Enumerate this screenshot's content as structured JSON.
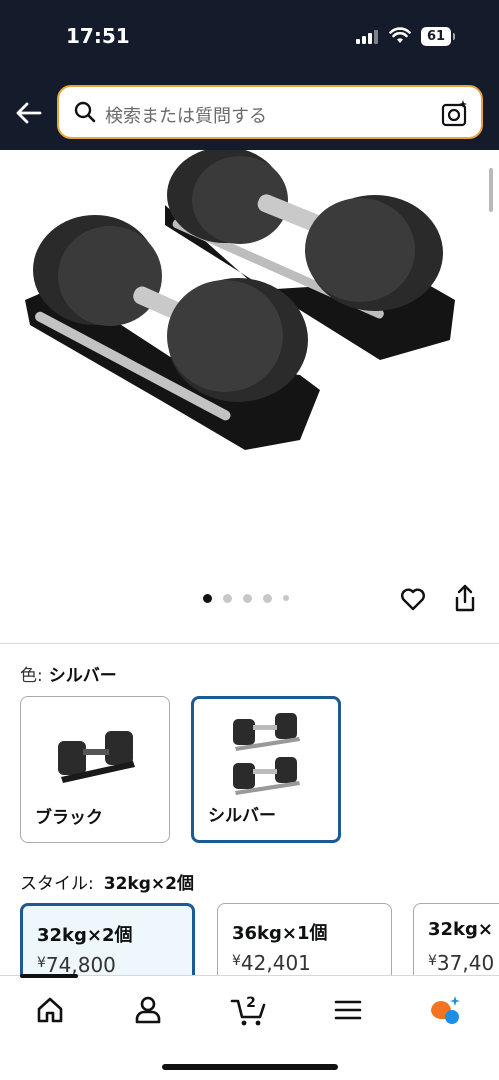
{
  "status_bar": {
    "time": "17:51",
    "battery": "61"
  },
  "search": {
    "placeholder": "検索または質問する"
  },
  "gallery": {
    "dots_total": 5,
    "active_index": 0
  },
  "color": {
    "label": "色:",
    "selected": "シルバー",
    "options": [
      {
        "label": "ブラック",
        "selected": false
      },
      {
        "label": "シルバー",
        "selected": true
      }
    ]
  },
  "style": {
    "label": "スタイル:",
    "selected": "32kg×2個",
    "options": [
      {
        "name": "32kg×2個",
        "currency": "¥",
        "price": "74,800",
        "selected": true
      },
      {
        "name": "36kg×1個",
        "currency": "¥",
        "price": "42,401",
        "selected": false
      },
      {
        "name": "32kg×",
        "currency": "¥",
        "price": "37,40",
        "selected": false
      }
    ]
  },
  "bottom_nav": {
    "items": [
      "home-icon",
      "account-icon",
      "cart-icon",
      "menu-icon",
      "rufus-assistant-icon"
    ],
    "cart_count": "2"
  },
  "colors": {
    "header_bg": "#141c2c",
    "selected_border": "#1d5a92",
    "assistant_orange": "#f27420",
    "assistant_blue": "#1c8ee8"
  }
}
